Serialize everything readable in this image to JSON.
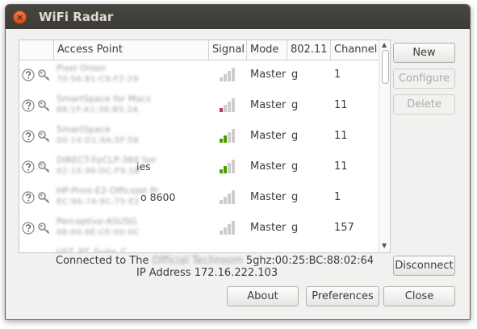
{
  "window": {
    "title": "WiFi Radar",
    "close_icon": "×"
  },
  "table": {
    "columns": [
      "",
      "Access Point",
      "Signal",
      "Mode",
      "802.11",
      "Channel"
    ],
    "rows": [
      {
        "ap_name": "Pixel Onion",
        "ap_mac": "70:56:81:C9:F2:29",
        "ap_suffix": "",
        "signal_level": 0,
        "mode": "Master",
        "protocol": "g",
        "channel": "1"
      },
      {
        "ap_name": "SmartSpace for Macs",
        "ap_mac": "88:1F:A1:36:B5:2A",
        "ap_suffix": "",
        "signal_level": 1,
        "mode": "Master",
        "protocol": "g",
        "channel": "11"
      },
      {
        "ap_name": "SmartSpace",
        "ap_mac": "00:14:D1:9A:5F:58",
        "ap_suffix": "",
        "signal_level": 2,
        "mode": "Master",
        "protocol": "g",
        "channel": "11"
      },
      {
        "ap_name": "DIRECT-FpCLP-360 Ser",
        "ap_mac": "02:15:99:DC:F9:1B",
        "ap_suffix": "ies",
        "signal_level": 2,
        "mode": "Master",
        "protocol": "g",
        "channel": "11"
      },
      {
        "ap_name": "HP-Print-E2-Officejet Pr",
        "ap_mac": "EC:9A:74:9C:75:E2",
        "ap_suffix": "o 8600",
        "signal_level": 0,
        "mode": "Master",
        "protocol": "g",
        "channel": "1"
      },
      {
        "ap_name": "Perceptive-ASUSG",
        "ap_mac": "08:60:6E:CE:00:0C",
        "ap_suffix": "",
        "signal_level": 0,
        "mode": "Master",
        "protocol": "g",
        "channel": "157"
      },
      {
        "ap_name": "UST_PT_Suite_C",
        "ap_mac": "",
        "ap_suffix": "",
        "signal_level": 0,
        "mode": "",
        "protocol": "",
        "channel": ""
      }
    ]
  },
  "buttons": {
    "new": "New",
    "configure": "Configure",
    "delete": "Delete",
    "disconnect": "Disconnect",
    "about": "About",
    "preferences": "Preferences",
    "close": "Close"
  },
  "status": {
    "connected_prefix": "Connected to The",
    "connected_ssid": "Official Techroom",
    "connected_suffix": "5ghz:00:25:BC:88:02:64",
    "ip_line": "IP Address 172.16.222.103"
  },
  "colors": {
    "signal_red": "#c7325a",
    "signal_green": "#4e9a06",
    "signal_empty": "#cfcdca"
  }
}
